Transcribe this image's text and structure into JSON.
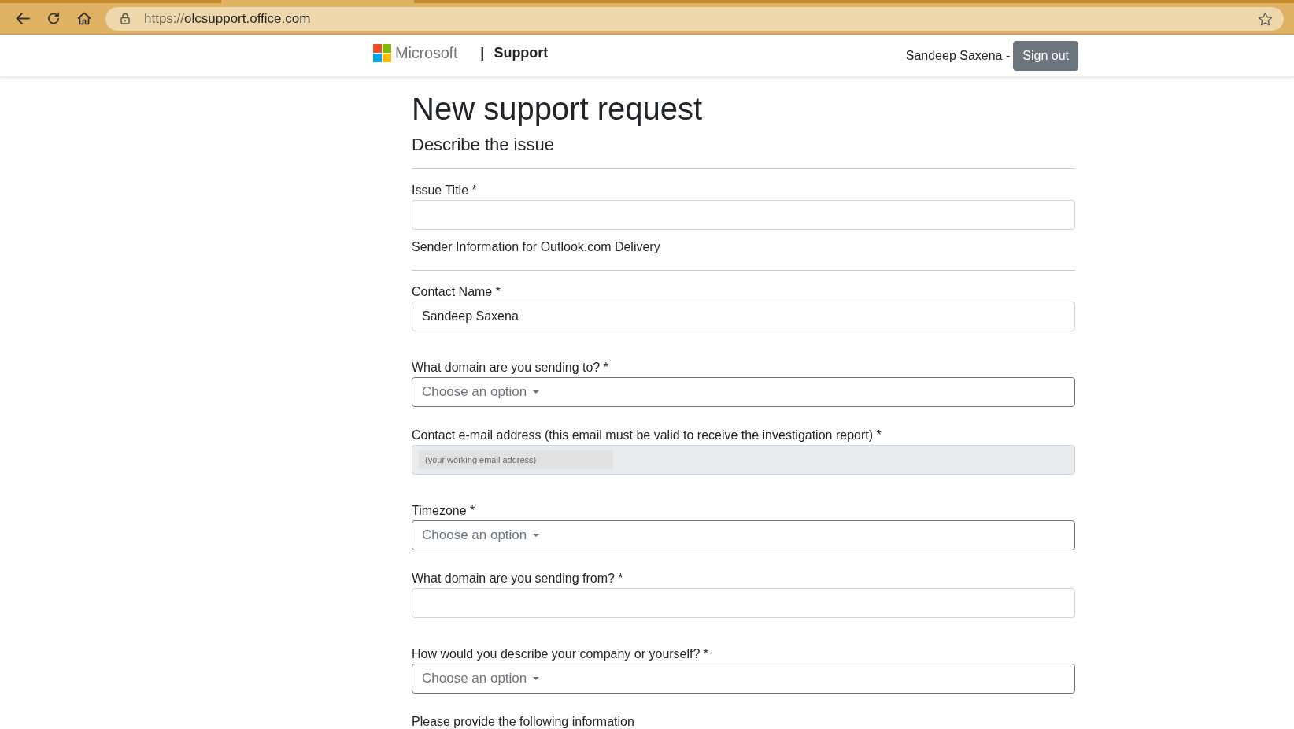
{
  "browser": {
    "url_scheme": "https://",
    "url_host": "olcsupport.office.com"
  },
  "header": {
    "brand": "Microsoft",
    "separator": "|",
    "section": "Support",
    "user": "Sandeep Saxena -",
    "sign_out": "Sign out"
  },
  "page": {
    "title": "New support request",
    "subtitle": "Describe the issue"
  },
  "form": [
    {
      "kind": "text",
      "label": "Issue Title *"
    },
    {
      "kind": "note",
      "text": "Sender Information for Outlook.com Delivery"
    },
    {
      "kind": "divider"
    },
    {
      "kind": "text",
      "label": "Contact Name *",
      "value": "Sandeep Saxena"
    },
    {
      "kind": "select",
      "label": "What domain are you sending to? *",
      "placeholder": "Choose an option"
    },
    {
      "kind": "embedded",
      "label": "Contact e-mail address (this email must be valid to receive the investigation report) *",
      "placeholder": "(your working email address)"
    },
    {
      "kind": "select",
      "label": "Timezone *",
      "placeholder": "Choose an option"
    },
    {
      "kind": "text",
      "label": "What domain are you sending from? *"
    },
    {
      "kind": "select",
      "label": "How would you describe your company or yourself? *",
      "placeholder": "Choose an option"
    },
    {
      "kind": "note",
      "text": "Please provide the following information"
    }
  ]
}
